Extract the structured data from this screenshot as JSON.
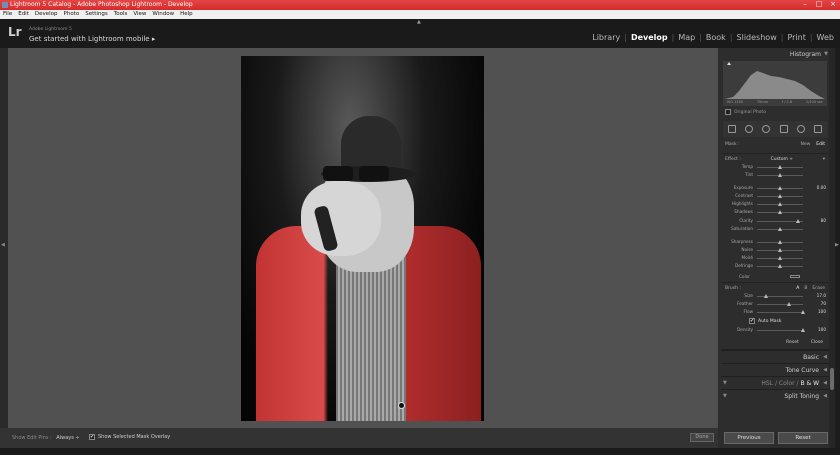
{
  "window": {
    "title": "Lightroom 5 Catalog - Adobe Photoshop Lightroom - Develop",
    "controls": [
      "–",
      "□",
      "×"
    ]
  },
  "menu": [
    "File",
    "Edit",
    "Develop",
    "Photo",
    "Settings",
    "Tools",
    "View",
    "Window",
    "Help"
  ],
  "identity": {
    "logo": "Lr",
    "product": "Adobe Lightroom 5",
    "mobile_prompt": "Get started with Lightroom mobile ▸"
  },
  "modules": [
    {
      "label": "Library",
      "active": false
    },
    {
      "label": "Develop",
      "active": true
    },
    {
      "label": "Map",
      "active": false
    },
    {
      "label": "Book",
      "active": false
    },
    {
      "label": "Slideshow",
      "active": false
    },
    {
      "label": "Print",
      "active": false
    },
    {
      "label": "Web",
      "active": false
    }
  ],
  "toolbar": {
    "show_edit_pins_label": "Show Edit Pins :",
    "show_edit_pins_value": "Always ÷",
    "overlay_label": "Show Selected Mask Overlay",
    "overlay_checked": "✔",
    "done_label": "Done"
  },
  "right_panel": {
    "histogram_title": "Histogram",
    "histogram_info": [
      "ISO 1250",
      "70mm",
      "f / 2.8",
      "1/100 sec"
    ],
    "original_photo": "Original Photo",
    "mask": {
      "label": "Mask :",
      "new": "New",
      "edit": "Edit"
    },
    "effect": {
      "label": "Effect :",
      "value": "Custom ÷"
    },
    "sliders": [
      {
        "label": "Temp",
        "value": "",
        "pos": 0.5
      },
      {
        "label": "Tint",
        "value": "",
        "pos": 0.5
      },
      {
        "label": "Exposure",
        "value": "0.00",
        "pos": 0.5
      },
      {
        "label": "Contrast",
        "value": "",
        "pos": 0.5
      },
      {
        "label": "Highlights",
        "value": "",
        "pos": 0.5
      },
      {
        "label": "Shadows",
        "value": "",
        "pos": 0.5
      },
      {
        "label": "Clarity",
        "value": "80",
        "pos": 0.9
      },
      {
        "label": "Saturation",
        "value": "",
        "pos": 0.5
      },
      {
        "label": "Sharpness",
        "value": "",
        "pos": 0.5
      },
      {
        "label": "Noise",
        "value": "",
        "pos": 0.5
      },
      {
        "label": "Moiré",
        "value": "",
        "pos": 0.5
      },
      {
        "label": "Defringe",
        "value": "",
        "pos": 0.5
      }
    ],
    "color_label": "Color",
    "brush": {
      "label": "Brush :",
      "a": "A",
      "b": "B",
      "erase": "Erase",
      "sliders": [
        {
          "label": "Size",
          "value": "17.0",
          "pos": 0.2
        },
        {
          "label": "Feather",
          "value": "70",
          "pos": 0.7
        },
        {
          "label": "Flow",
          "value": "100",
          "pos": 1.0
        }
      ],
      "auto_mask": "Auto Mask",
      "auto_mask_checked": "✔",
      "density": {
        "label": "Density",
        "value": "100",
        "pos": 1.0
      }
    },
    "reset_label": "Reset",
    "close_label": "Close",
    "sections": {
      "basic": "Basic",
      "tone_curve": "Tone Curve",
      "hsl": "HSL",
      "color": "Color",
      "bw": "B & W",
      "split_toning": "Split Toning"
    },
    "previous_label": "Previous",
    "reset_button": "Reset"
  }
}
